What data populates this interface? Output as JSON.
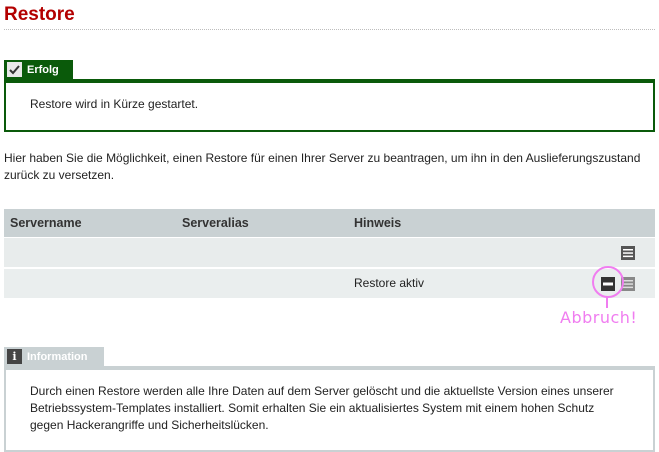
{
  "page": {
    "title": "Restore"
  },
  "success": {
    "tab_label": "Erfolg",
    "message": "Restore wird in Kürze gestartet."
  },
  "intro": {
    "text": "Hier haben Sie die Möglichkeit, einen Restore für einen Ihrer Server zu beantragen, um ihn in den Auslieferungszustand zurück zu versetzen."
  },
  "table": {
    "headers": {
      "servername": "Servername",
      "serveralias": "Serveralias",
      "hinweis": "Hinweis"
    },
    "rows": [
      {
        "servername": "",
        "serveralias": "",
        "hinweis": ""
      },
      {
        "servername": "",
        "serveralias": "",
        "hinweis": "Restore aktiv"
      }
    ]
  },
  "annotation": {
    "label": "Abbruch!"
  },
  "info": {
    "tab_label": "Information",
    "icon_glyph": "i",
    "text": "Durch einen Restore werden alle Ihre Daten auf dem Server gelöscht und die aktuellste Version eines unserer Betriebssystem-Templates installiert. Somit erhalten Sie ein aktualisiertes System mit einem hohen Schutz gegen Hackerangriffe und Sicherheitslücken."
  },
  "colors": {
    "title": "#b30000",
    "success": "#0a5a0a",
    "table_header": "#c9d1d3",
    "annotation": "#f07df0"
  }
}
